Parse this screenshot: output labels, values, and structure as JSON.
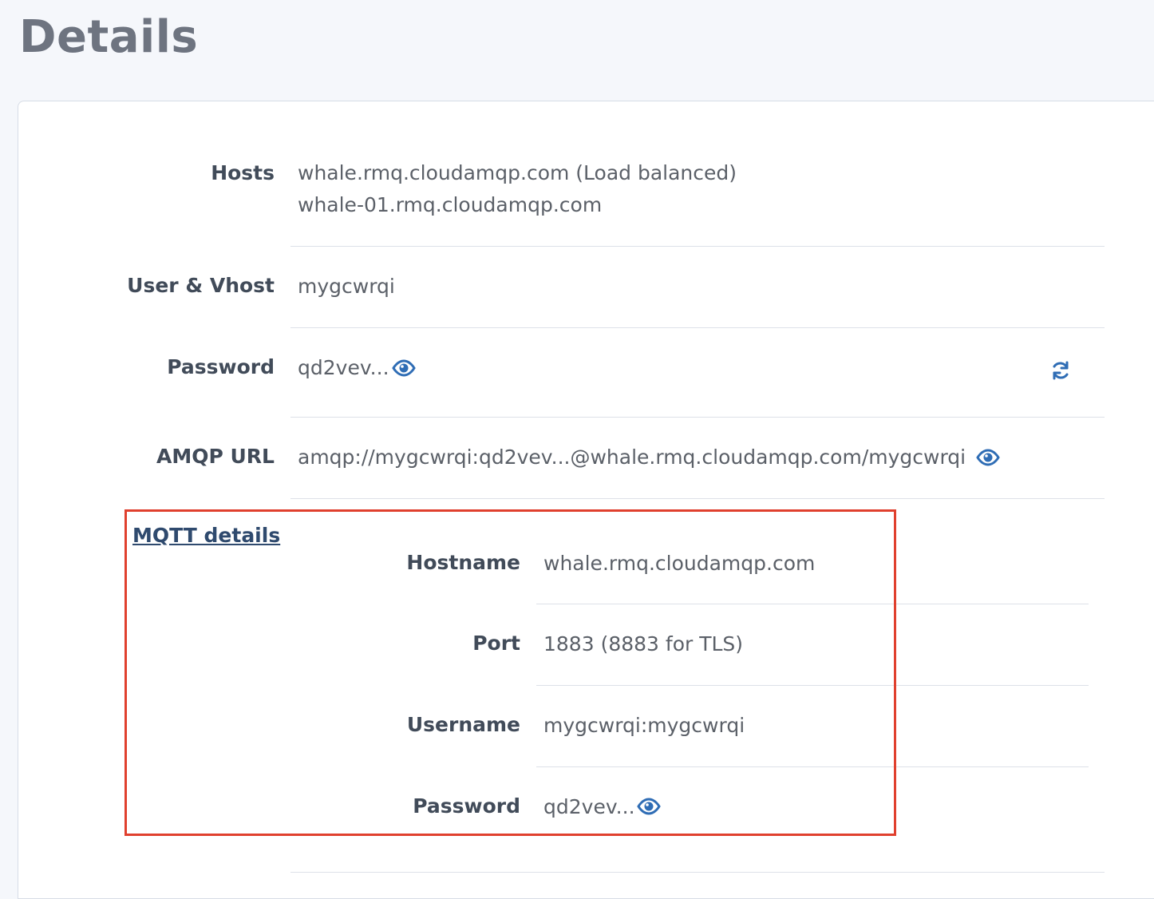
{
  "page": {
    "title": "Details"
  },
  "details": {
    "hosts_label": "Hosts",
    "hosts": [
      "whale.rmq.cloudamqp.com (Load balanced)",
      "whale-01.rmq.cloudamqp.com"
    ],
    "user_vhost_label": "User & Vhost",
    "user_vhost": "mygcwrqi",
    "password_label": "Password",
    "password_masked": "qd2vev...",
    "amqp_url_label": "AMQP URL",
    "amqp_url": "amqp://mygcwrqi:qd2vev...@whale.rmq.cloudamqp.com/mygcwrqi"
  },
  "mqtt": {
    "link_label": "MQTT details",
    "hostname_label": "Hostname",
    "hostname": "whale.rmq.cloudamqp.com",
    "port_label": "Port",
    "port": "1883 (8883 for TLS)",
    "username_label": "Username",
    "username": "mygcwrqi:mygcwrqi",
    "password_label": "Password",
    "password_masked": "qd2vev..."
  },
  "icons": {
    "reveal": "eye-icon",
    "rotate": "refresh-icon"
  },
  "colors": {
    "accent": "#2f6db5",
    "highlight": "#e0402e",
    "label": "#414b59",
    "link": "#2f4a6e"
  }
}
